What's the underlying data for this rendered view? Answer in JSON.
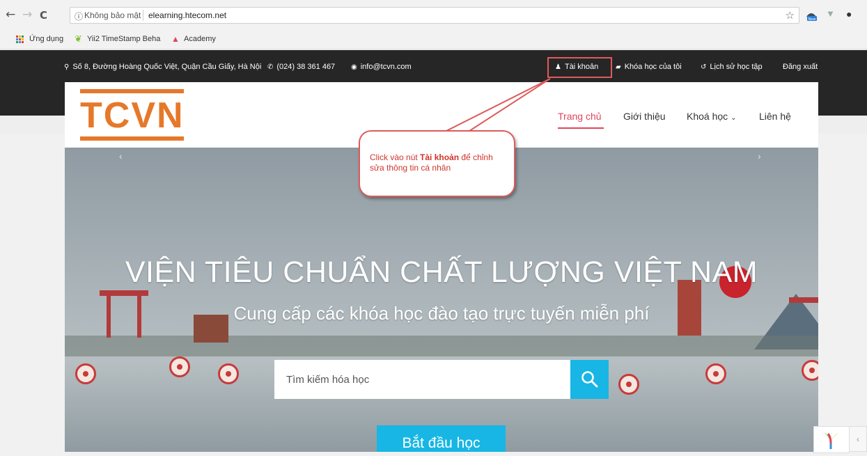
{
  "browser": {
    "back": "←",
    "forward": "→",
    "reload": "C",
    "security": "Không bảo mật",
    "url": "elearning.htecom.net",
    "star": "☆"
  },
  "bookmarks": [
    "Ứng dụng",
    "Yii2 TimeStamp Beha",
    "Academy"
  ],
  "topbar": {
    "address": "Số 8, Đường Hoàng Quốc Việt, Quận Cầu Giấy, Hà Nội",
    "phone": "(024) 38 361 467",
    "email": "info@tcvn.com",
    "account": "Tài khoản",
    "my_courses": "Khóa học của tôi",
    "history": "Lịch sử học tập",
    "logout": "Đăng xuất"
  },
  "header": {
    "logo": "TCVN",
    "nav": [
      "Trang chủ",
      "Giới thiệu",
      "Khoá học",
      "Liên hệ"
    ]
  },
  "hero": {
    "title": "VIỆN TIÊU CHUẨN CHẤT LƯỢNG VIỆT NAM",
    "subtitle": "Cung cấp các khóa học đào tạo trực tuyến miễn phí",
    "prev": "‹",
    "next": "›",
    "search_placeholder": "Tìm kiếm hóa học",
    "start": "Bắt đầu học"
  },
  "callout": {
    "pre": "Click vào nút ",
    "bold": "Tài khoản",
    "post": " để chỉnh sửa thông tin cá nhân"
  },
  "colors": {
    "accent": "#e0445a",
    "logo": "#e6782a",
    "button": "#17b6e4",
    "topbar": "#262626",
    "callout_border": "#dd5b5b"
  }
}
